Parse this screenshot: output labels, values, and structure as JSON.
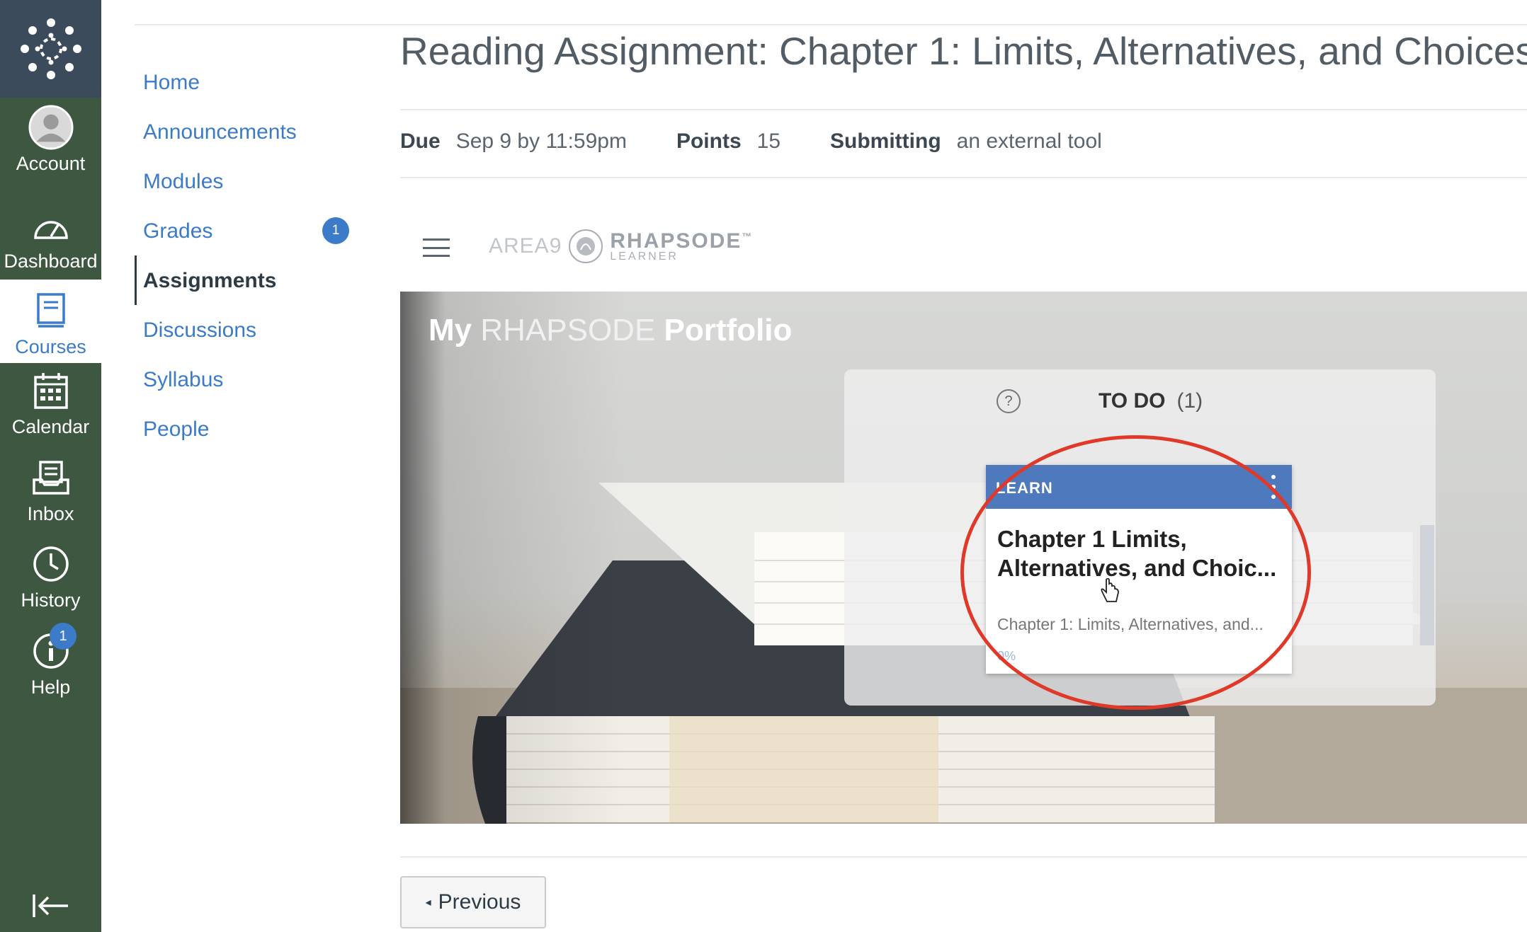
{
  "global_nav": {
    "items": [
      {
        "label": "Account",
        "icon": "account-icon"
      },
      {
        "label": "Dashboard",
        "icon": "dashboard-icon"
      },
      {
        "label": "Courses",
        "icon": "courses-icon",
        "active": true
      },
      {
        "label": "Calendar",
        "icon": "calendar-icon"
      },
      {
        "label": "Inbox",
        "icon": "inbox-icon"
      },
      {
        "label": "History",
        "icon": "history-icon"
      },
      {
        "label": "Help",
        "icon": "help-icon",
        "badge": "1"
      }
    ],
    "collapse_icon": "collapse-arrow-icon",
    "colors": {
      "bar": "#3e5741",
      "logo_box": "#3c4b5c",
      "active_text": "#3b7bc7"
    }
  },
  "course_nav": {
    "items": [
      {
        "label": "Home"
      },
      {
        "label": "Announcements"
      },
      {
        "label": "Modules"
      },
      {
        "label": "Grades",
        "badge": "1"
      },
      {
        "label": "Assignments",
        "active": true
      },
      {
        "label": "Discussions"
      },
      {
        "label": "Syllabus"
      },
      {
        "label": "People"
      }
    ]
  },
  "assignment": {
    "title": "Reading Assignment: Chapter 1: Limits, Alternatives, and Choices",
    "due_label": "Due",
    "due_value": "Sep 9 by 11:59pm",
    "points_label": "Points",
    "points_value": "15",
    "submitting_label": "Submitting",
    "submitting_value": "an external tool"
  },
  "tool": {
    "brand_area9": "AREA9",
    "brand_name": "RHAPSODE",
    "brand_tm": "™",
    "brand_sub": "LEARNER",
    "portfolio_title_my": "My",
    "portfolio_title_rhapsode": "RHAPSODE",
    "portfolio_title_portfolio": "Portfolio",
    "todo_title": "TO DO",
    "todo_count": "(1)",
    "card": {
      "label": "LEARN",
      "title": "Chapter 1 Limits, Alternatives, and Choic...",
      "subtitle": "Chapter 1: Limits, Alternatives, and...",
      "progress": "0%"
    }
  },
  "footer": {
    "previous_label": "Previous"
  }
}
